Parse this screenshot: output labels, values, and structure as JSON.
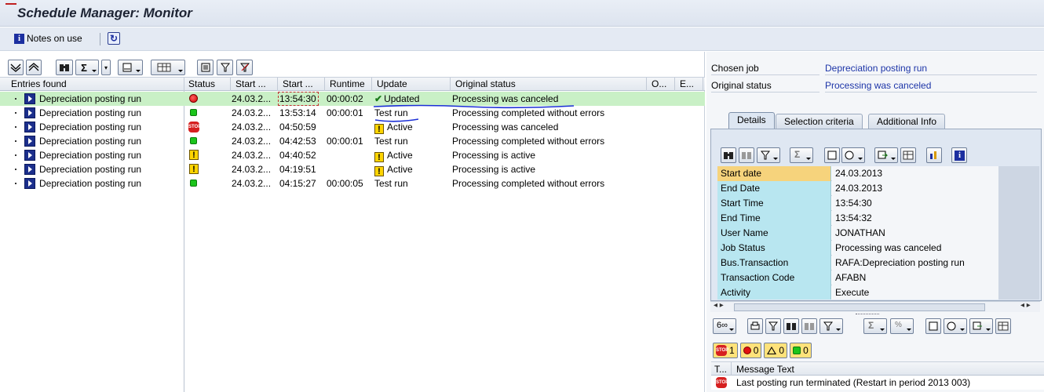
{
  "window": {
    "title": "Schedule Manager: Monitor"
  },
  "app_toolbar": {
    "notes_label": "Notes on use"
  },
  "grid": {
    "headers": [
      "Entries found",
      "Status",
      "Start ...",
      "Start ...",
      "Runtime",
      "Update",
      "Original status",
      "O...",
      "E..."
    ],
    "rows": [
      {
        "name": "Depreciation posting run",
        "status": "red-light",
        "date": "24.03.2...",
        "time": "13:54:30",
        "runtime": "00:00:02",
        "update": "Updated",
        "original": "Processing was canceled"
      },
      {
        "name": "Depreciation posting run",
        "status": "green",
        "date": "24.03.2...",
        "time": "13:53:14",
        "runtime": "00:00:01",
        "update": "Test run",
        "original": "Processing completed without errors"
      },
      {
        "name": "Depreciation posting run",
        "status": "stop",
        "date": "24.03.2...",
        "time": "04:50:59",
        "runtime": "",
        "update": "Active",
        "original": "Processing was canceled"
      },
      {
        "name": "Depreciation posting run",
        "status": "green",
        "date": "24.03.2...",
        "time": "04:42:53",
        "runtime": "00:00:01",
        "update": "Test run",
        "original": "Processing completed without errors"
      },
      {
        "name": "Depreciation posting run",
        "status": "warning",
        "date": "24.03.2...",
        "time": "04:40:52",
        "runtime": "",
        "update": "Active",
        "original": "Processing is active"
      },
      {
        "name": "Depreciation posting run",
        "status": "warning",
        "date": "24.03.2...",
        "time": "04:19:51",
        "runtime": "",
        "update": "Active",
        "original": "Processing is active"
      },
      {
        "name": "Depreciation posting run",
        "status": "green",
        "date": "24.03.2...",
        "time": "04:15:27",
        "runtime": "00:00:05",
        "update": "Test run",
        "original": "Processing completed without errors"
      }
    ]
  },
  "detail": {
    "chosen_job_label": "Chosen job",
    "chosen_job_value": "Depreciation posting run",
    "original_status_label": "Original status",
    "original_status_value": "Processing was canceled",
    "tabs": [
      "Details",
      "Selection criteria",
      "Additional Info"
    ],
    "active_tab": "Details",
    "fields": [
      {
        "label": "Start date",
        "value": "24.03.2013"
      },
      {
        "label": "End Date",
        "value": "24.03.2013"
      },
      {
        "label": "Start Time",
        "value": "13:54:30"
      },
      {
        "label": "End Time",
        "value": "13:54:32"
      },
      {
        "label": "User Name",
        "value": "JONATHAN"
      },
      {
        "label": "Job Status",
        "value": "Processing was canceled"
      },
      {
        "label": "Bus.Transaction",
        "value": "RAFA:Depreciation posting run"
      },
      {
        "label": "Transaction Code",
        "value": "AFABN"
      },
      {
        "label": "Activity",
        "value": "Execute"
      }
    ]
  },
  "messages": {
    "counts": {
      "stop": "1",
      "error": "0",
      "warning": "0",
      "success": "0"
    },
    "headers": [
      "T...",
      "Message Text"
    ],
    "rows": [
      {
        "type": "stop",
        "text": "Last posting run terminated (Restart in period 2013 003)"
      }
    ]
  },
  "colors": {
    "selected_row": "#c9f0c6",
    "accent_blue": "#1d35a8",
    "label_cell": "#b8e6f0",
    "label_cell_first": "#f6d37c"
  }
}
